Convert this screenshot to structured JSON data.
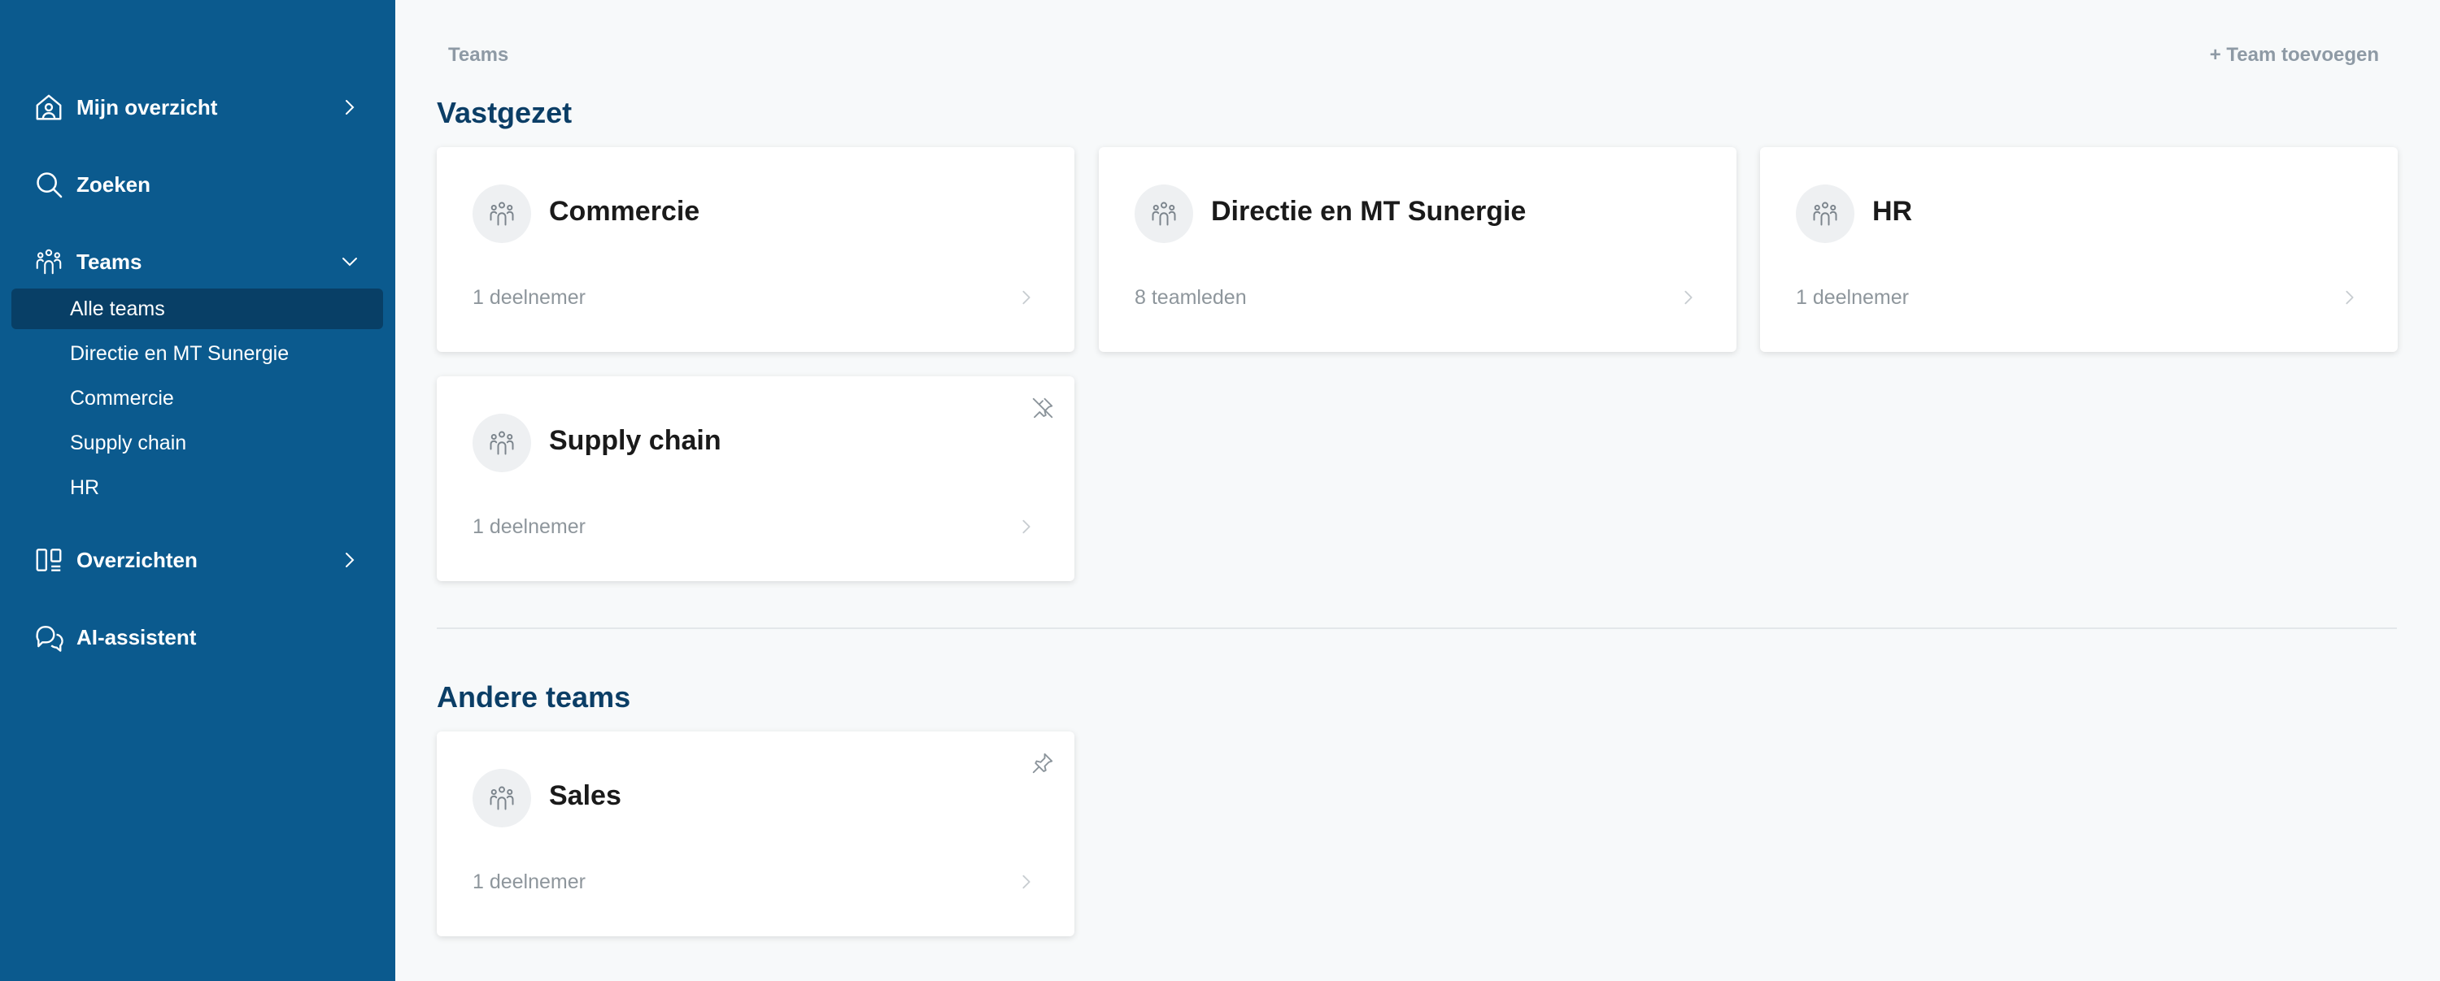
{
  "sidebar": {
    "items": [
      {
        "label": "Mijn overzicht",
        "icon": "home-user-icon"
      },
      {
        "label": "Zoeken",
        "icon": "search-icon"
      },
      {
        "label": "Teams",
        "icon": "team-icon"
      },
      {
        "label": "Overzichten",
        "icon": "overview-icon"
      },
      {
        "label": "AI-assistent",
        "icon": "chat-icon"
      }
    ],
    "teams_sub": [
      {
        "label": "Alle teams",
        "active": true
      },
      {
        "label": "Directie en MT Sunergie"
      },
      {
        "label": "Commercie"
      },
      {
        "label": "Supply chain"
      },
      {
        "label": "HR"
      }
    ]
  },
  "header": {
    "breadcrumb": "Teams",
    "add_button": "+ Team toevoegen"
  },
  "sections": {
    "pinned_title": "Vastgezet",
    "others_title": "Andere teams"
  },
  "pinned_teams": [
    {
      "name": "Commercie",
      "count": "1 deelnemer"
    },
    {
      "name": "Directie en MT Sunergie",
      "count": "8 teamleden"
    },
    {
      "name": "HR",
      "count": "1 deelnemer"
    },
    {
      "name": "Supply chain",
      "count": "1 deelnemer",
      "pin_icon": "unpin-icon"
    }
  ],
  "other_teams": [
    {
      "name": "Sales",
      "count": "1 deelnemer",
      "pin_icon": "pin-icon"
    }
  ],
  "colors": {
    "sidebar_bg": "#0b5a8e",
    "sidebar_active": "#083f66",
    "title": "#0b3e66",
    "page_bg": "#f7f9fa"
  }
}
